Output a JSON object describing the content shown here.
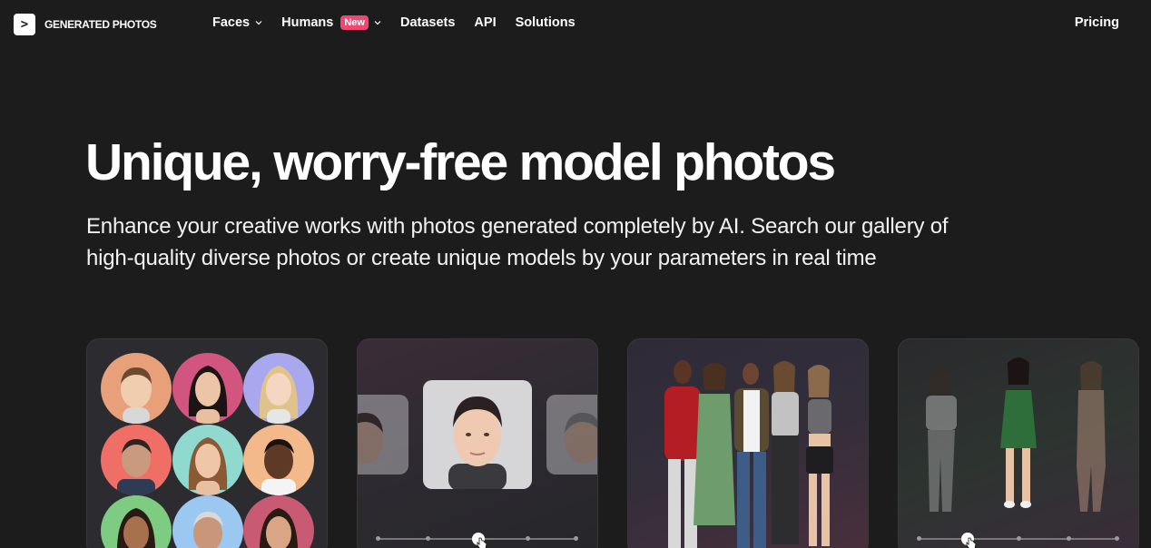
{
  "nav": {
    "logo_text": "GENERATED PHOTOS",
    "items": [
      {
        "label": "Faces",
        "has_dropdown": true
      },
      {
        "label": "Humans",
        "badge": "New",
        "has_dropdown": true
      },
      {
        "label": "Datasets"
      },
      {
        "label": "API"
      },
      {
        "label": "Solutions"
      }
    ],
    "right_link": "Pricing"
  },
  "hero": {
    "title": "Unique, worry-free model photos",
    "subtitle_line1": "Enhance your creative works with photos generated completely by AI. Search our gallery of",
    "subtitle_line2": "high-quality diverse photos or create unique models by your parameters in real time"
  },
  "colors": {
    "background": "#1c1c1d",
    "badge": "#f0466f",
    "text": "#ffffff",
    "face_circles": [
      "#e8a07a",
      "#d1557e",
      "#a9a8ef",
      "#ef6f66",
      "#8fd9cf",
      "#f3b98a",
      "#7ecb82",
      "#9bc8f0",
      "#c95a73"
    ]
  },
  "cards": [
    {
      "name": "face-gallery-card"
    },
    {
      "name": "face-generator-card"
    },
    {
      "name": "human-gallery-card"
    },
    {
      "name": "human-generator-card"
    }
  ]
}
